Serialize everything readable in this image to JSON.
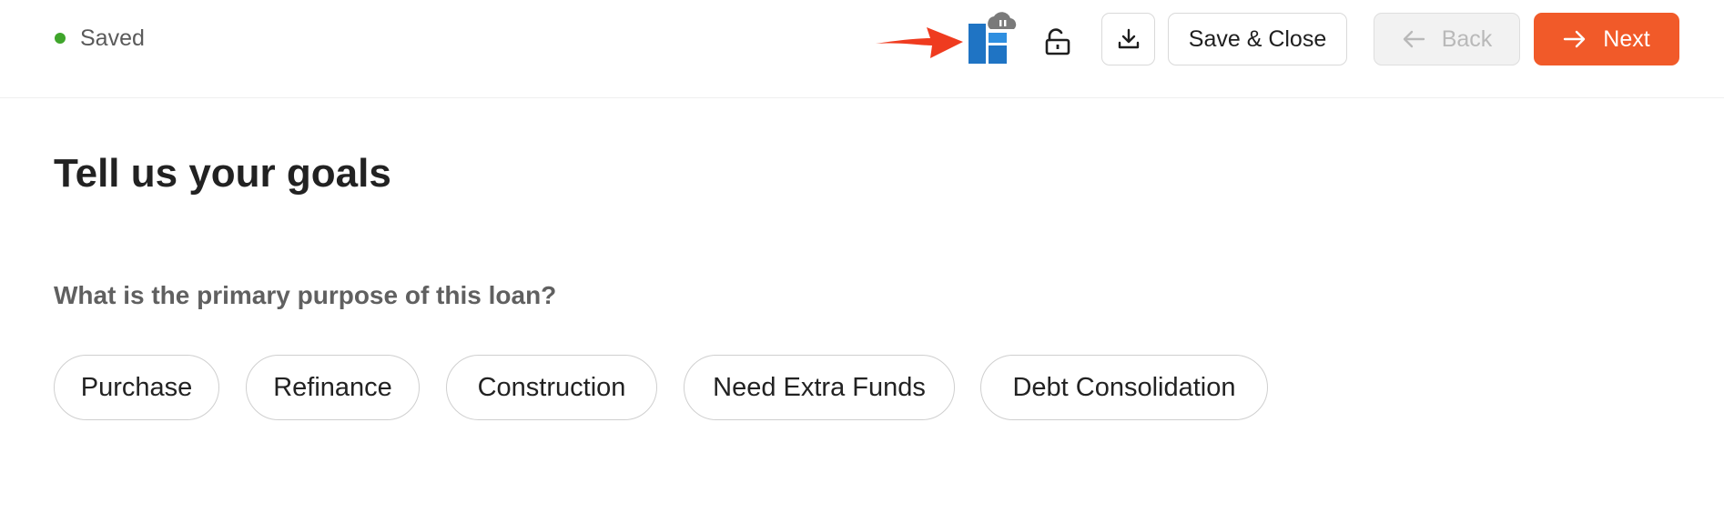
{
  "header": {
    "status_label": "Saved",
    "status_color": "#3fa52b",
    "annotation": "red-arrow-pointer",
    "app_icon": "app-logo-icon",
    "lock_icon": "unlock-icon",
    "download_icon": "download-icon",
    "save_close_label": "Save & Close",
    "back_label": "Back",
    "next_label": "Next",
    "accent_color": "#f15a29"
  },
  "main": {
    "title": "Tell us your goals",
    "question": "What is the primary purpose of this loan?",
    "options": [
      {
        "label": "Purchase"
      },
      {
        "label": "Refinance"
      },
      {
        "label": "Construction"
      },
      {
        "label": "Need Extra Funds"
      },
      {
        "label": "Debt Consolidation"
      }
    ]
  }
}
